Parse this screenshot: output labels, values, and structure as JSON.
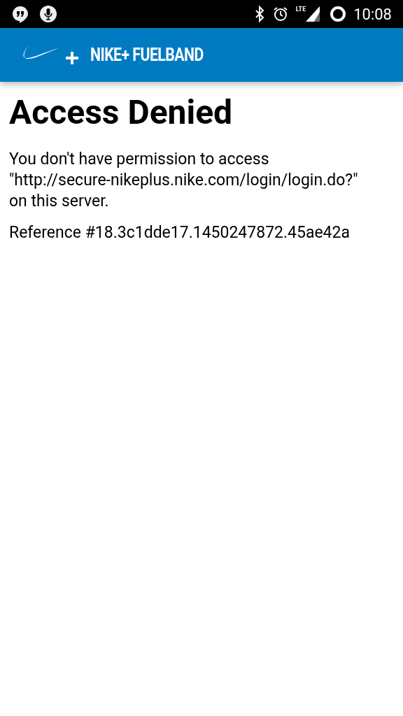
{
  "status_bar": {
    "time": "10:08",
    "network": "LTE"
  },
  "app_bar": {
    "title": "NIKE+ FUELBAND"
  },
  "page": {
    "heading": "Access Denied",
    "message": "You don't have permission to access \"http://secure-nikeplus.nike.com/login/login.do?\" on this server.",
    "reference": "Reference #18.3c1dde17.1450247872.45ae42a"
  }
}
